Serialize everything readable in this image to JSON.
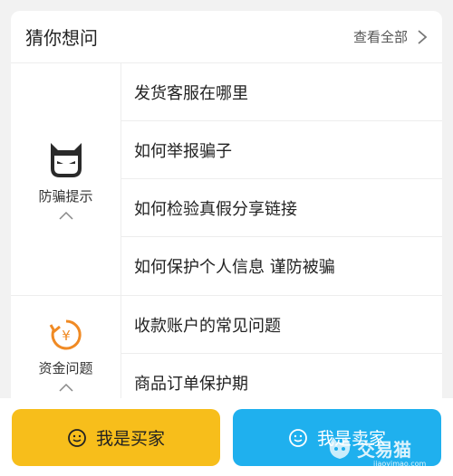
{
  "header": {
    "title": "猜你想问",
    "see_all": "查看全部"
  },
  "sections": [
    {
      "label": "防骗提示",
      "icon": "devil-face-icon",
      "items": [
        "发货客服在哪里",
        "如何举报骗子",
        "如何检验真假分享链接",
        "如何保护个人信息 谨防被骗"
      ]
    },
    {
      "label": "资金问题",
      "icon": "yuan-refresh-icon",
      "items": [
        "收款账户的常见问题",
        "商品订单保护期"
      ]
    }
  ],
  "buttons": {
    "buyer": "我是买家",
    "seller": "我是卖家"
  },
  "watermark": {
    "brand": "交易猫",
    "url": "jiaoyimao.com"
  },
  "colors": {
    "buyer_button": "#f7be1b",
    "seller_button": "#1fb0ee",
    "fund_icon": "#f08a24"
  }
}
